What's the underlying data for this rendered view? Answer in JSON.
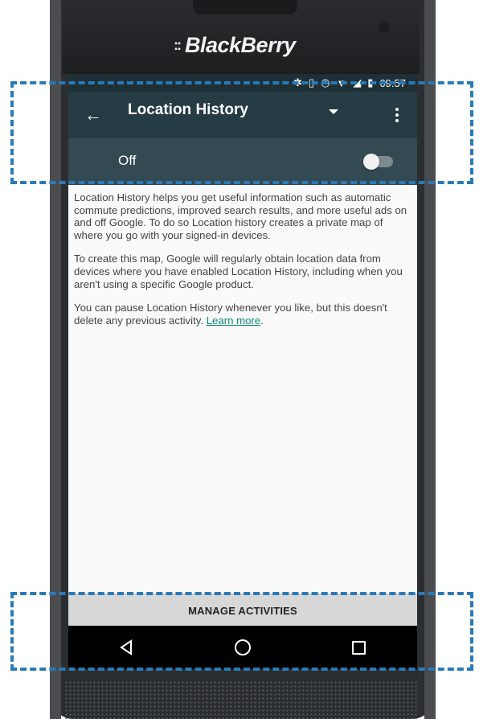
{
  "device": {
    "brand": "BlackBerry",
    "brand_logo": "::"
  },
  "status_bar": {
    "icons": [
      "bluetooth-icon",
      "vibrate-icon",
      "alarm-icon",
      "wifi-icon",
      "signal-icon",
      "battery-icon"
    ],
    "time": "09:57"
  },
  "app_bar": {
    "title": "Location History",
    "back_icon": "arrow-left-icon",
    "menu_icon": "more-vert-icon"
  },
  "toggle": {
    "label": "Off",
    "state": "off"
  },
  "content": {
    "paragraph_1": "Location History helps you get useful information such as automatic commute predictions, improved search results, and more useful ads on and off Google. To do so Location history creates a private map of where you go with your signed-in devices.",
    "paragraph_2": "To create this map, Google will regularly obtain location data from devices where you have enabled Location History, including when you aren't using a specific Google product.",
    "paragraph_3": "You can pause Location History whenever you like, but this doesn't delete any previous activity.",
    "learn_more": "Learn more",
    "period": "."
  },
  "footer": {
    "manage_label": "MANAGE ACTIVITIES"
  },
  "colors": {
    "app_bar": "#263c44",
    "toggle_row": "#344a53",
    "link": "#0a8a7a",
    "annotation": "#2a7ab8"
  }
}
